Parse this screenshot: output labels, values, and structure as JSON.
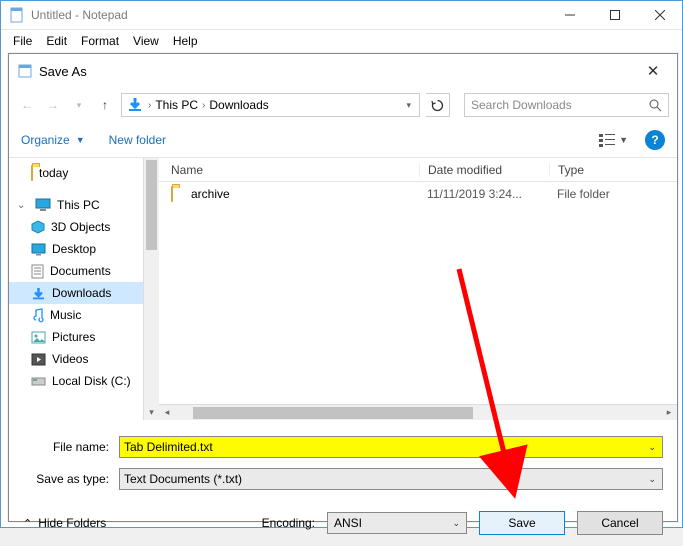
{
  "notepad": {
    "title": "Untitled - Notepad",
    "menus": [
      "File",
      "Edit",
      "Format",
      "View",
      "Help"
    ]
  },
  "dialog": {
    "title": "Save As",
    "breadcrumbs": [
      "This PC",
      "Downloads"
    ],
    "search_placeholder": "Search Downloads",
    "toolbar": {
      "organize": "Organize",
      "new_folder": "New folder"
    },
    "tree": {
      "today": "today",
      "this_pc": "This PC",
      "items": [
        "3D Objects",
        "Desktop",
        "Documents",
        "Downloads",
        "Music",
        "Pictures",
        "Videos",
        "Local Disk (C:)"
      ],
      "selected": "Downloads"
    },
    "columns": {
      "name": "Name",
      "date": "Date modified",
      "type": "Type"
    },
    "rows": [
      {
        "name": "archive",
        "date": "11/11/2019 3:24...",
        "type": "File folder"
      }
    ],
    "fields": {
      "file_name_label": "File name:",
      "file_name_value": "Tab Delimited.txt",
      "save_type_label": "Save as type:",
      "save_type_value": "Text Documents (*.txt)"
    },
    "footer": {
      "hide_folders": "Hide Folders",
      "encoding_label": "Encoding:",
      "encoding_value": "ANSI",
      "save": "Save",
      "cancel": "Cancel"
    }
  }
}
